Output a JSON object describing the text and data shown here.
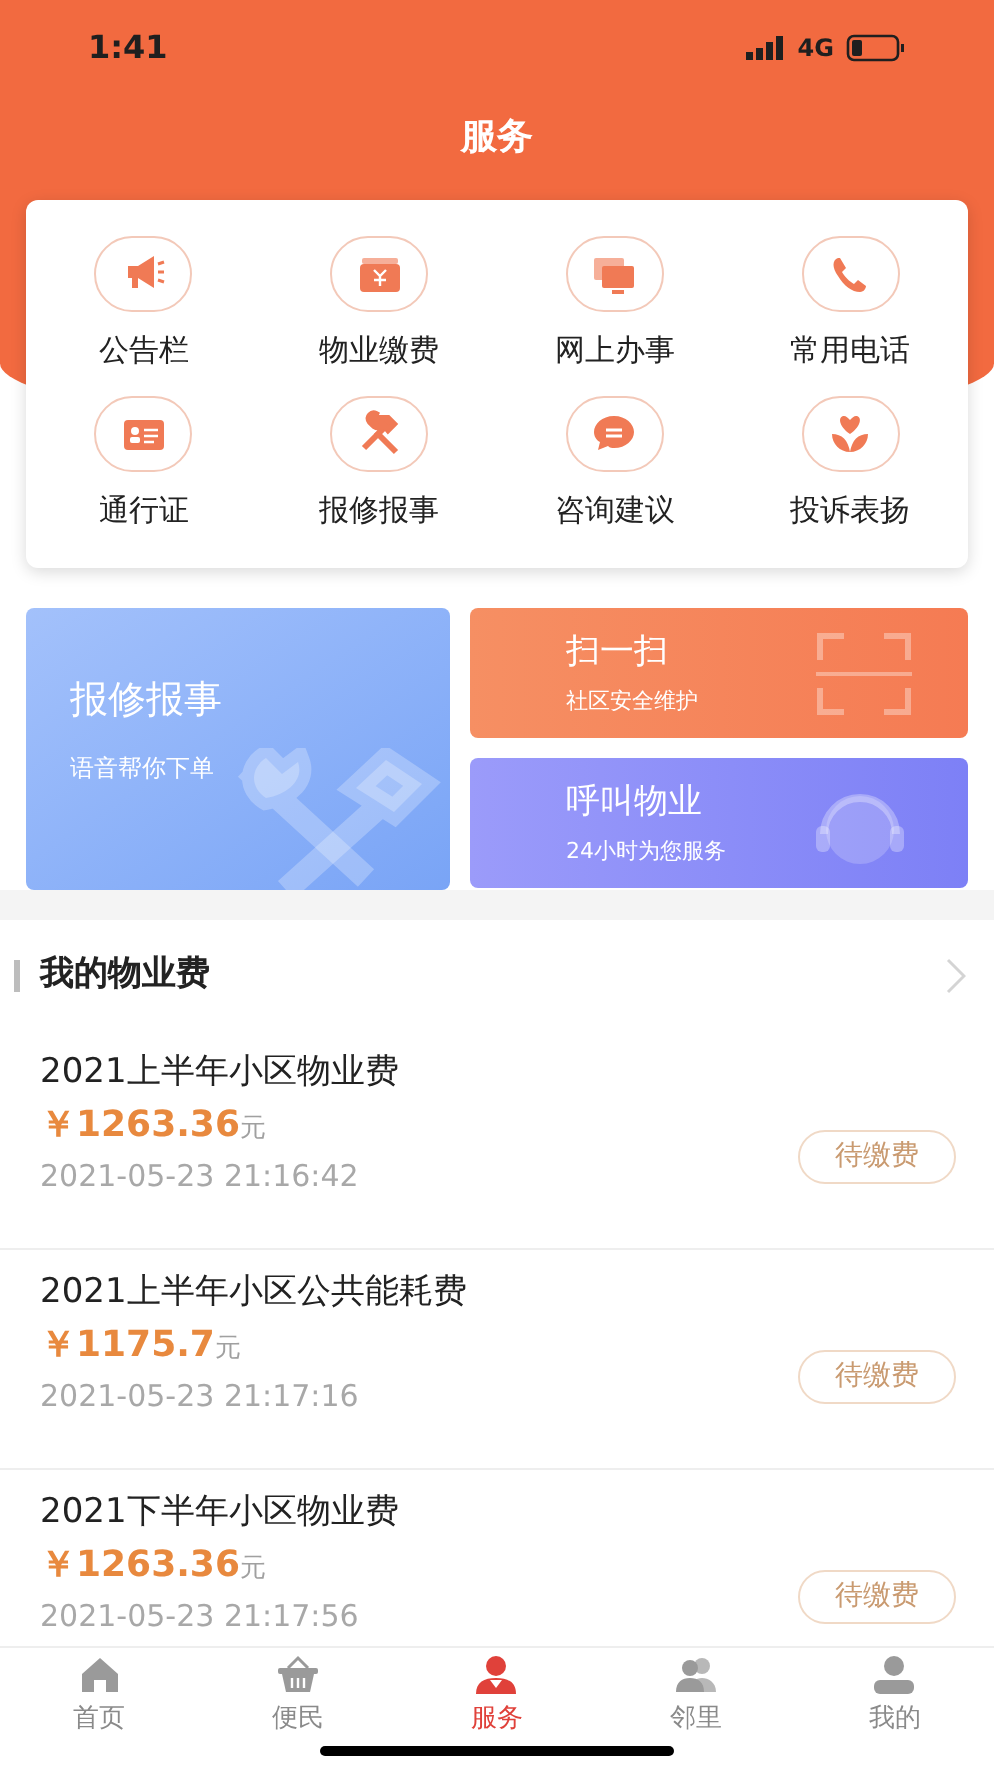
{
  "status_bar": {
    "time": "1:41",
    "network": "4G"
  },
  "title": "服务",
  "services": [
    {
      "label": "公告栏"
    },
    {
      "label": "物业缴费"
    },
    {
      "label": "网上办事"
    },
    {
      "label": "常用电话"
    },
    {
      "label": "通行证"
    },
    {
      "label": "报修报事"
    },
    {
      "label": "咨询建议"
    },
    {
      "label": "投诉表扬"
    }
  ],
  "banners": [
    {
      "kind": "repair",
      "title": "报修报事",
      "subtitle": "语音帮你下单"
    },
    {
      "kind": "scan",
      "title": "扫一扫",
      "subtitle": "社区安全维护"
    },
    {
      "kind": "call",
      "title": "呼叫物业",
      "subtitle": "24小时为您服务"
    }
  ],
  "fees": {
    "title": "我的物业费",
    "items": [
      {
        "name": "2021上半年小区物业费",
        "amount": "￥1263.36",
        "unit": "元",
        "time": "2021-05-23 21:16:42",
        "status": "待缴费"
      },
      {
        "name": "2021上半年小区公共能耗费",
        "amount": "￥1175.7",
        "unit": "元",
        "time": "2021-05-23 21:17:16",
        "status": "待缴费"
      },
      {
        "name": "2021下半年小区物业费",
        "amount": "￥1263.36",
        "unit": "元",
        "time": "2021-05-23 21:17:56",
        "status": "待缴费"
      }
    ]
  },
  "tab_bar": [
    {
      "label": "首页",
      "selected": false
    },
    {
      "label": "便民",
      "selected": false
    },
    {
      "label": "服务",
      "selected": true
    },
    {
      "label": "邻里",
      "selected": false
    },
    {
      "label": "我的",
      "selected": false
    }
  ]
}
